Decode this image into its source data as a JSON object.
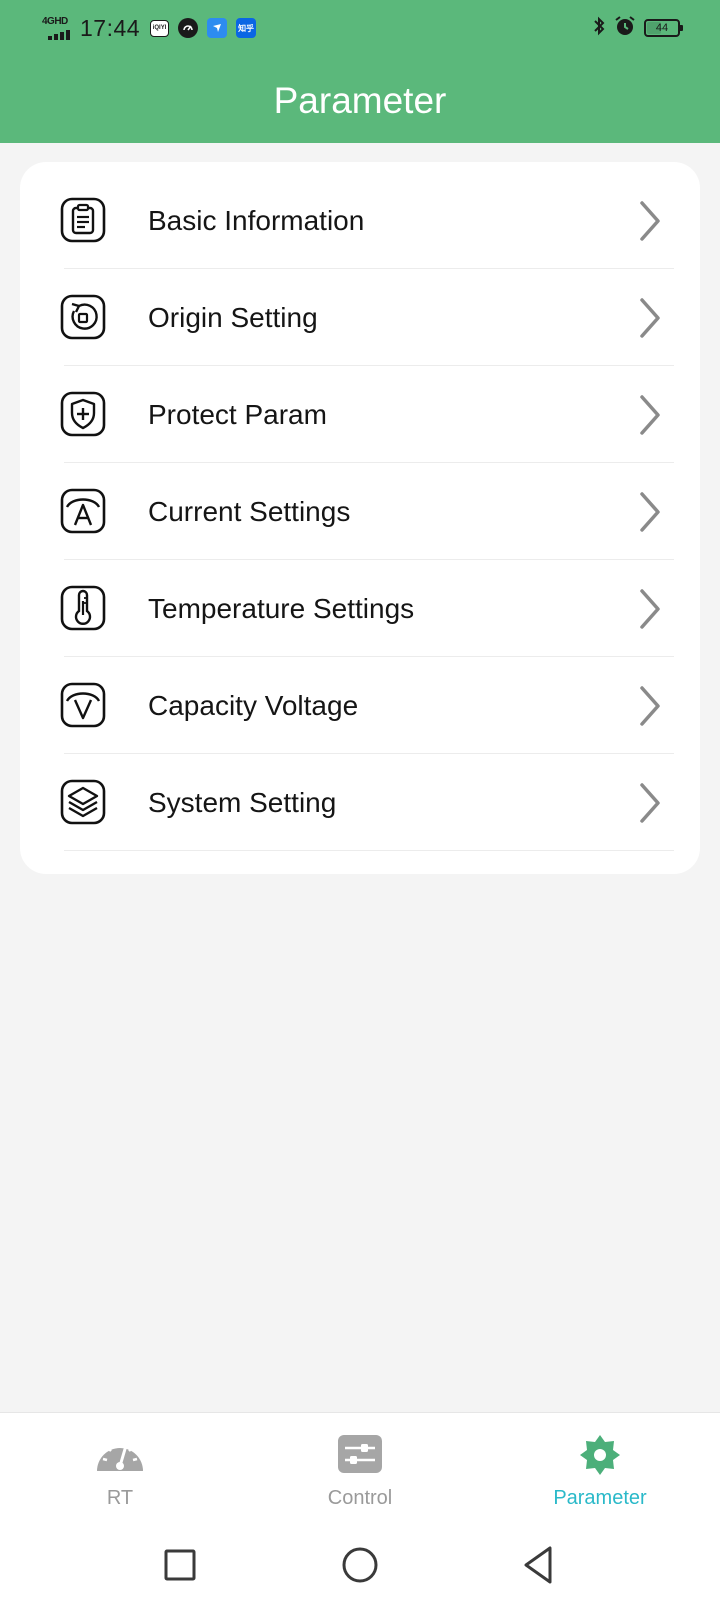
{
  "status_bar": {
    "network": "4GHD",
    "time": "17:44",
    "app_icons": [
      "iqiyi-icon",
      "speed-icon",
      "bird-app-icon",
      "zhihu-icon"
    ],
    "app_icon_labels": [
      "iQIYI",
      "",
      "",
      "知乎"
    ],
    "battery": "44",
    "right_icons": [
      "bluetooth-icon",
      "alarm-icon",
      "battery-icon"
    ]
  },
  "header": {
    "title": "Parameter",
    "background": "#5bb87b"
  },
  "menu": {
    "items": [
      {
        "label": "Basic Information",
        "icon": "clipboard-icon"
      },
      {
        "label": "Origin Setting",
        "icon": "reset-rotate-icon"
      },
      {
        "label": "Protect Param",
        "icon": "shield-plus-icon"
      },
      {
        "label": "Current Settings",
        "icon": "current-ampere-icon"
      },
      {
        "label": "Temperature Settings",
        "icon": "thermometer-icon"
      },
      {
        "label": "Capacity Voltage",
        "icon": "voltage-icon"
      },
      {
        "label": "System Setting",
        "icon": "layers-icon"
      }
    ],
    "chevron_icon": "chevron-right-icon"
  },
  "tabbar": {
    "tabs": [
      {
        "label": "RT",
        "icon": "speedometer-icon",
        "active": false
      },
      {
        "label": "Control",
        "icon": "sliders-icon",
        "active": false
      },
      {
        "label": "Parameter",
        "icon": "gear-icon",
        "active": true
      }
    ],
    "active_color": "#2ab9c9",
    "active_icon_color": "#4caf7a",
    "inactive_color": "#9a9a9a"
  },
  "navbar": {
    "buttons": [
      "recents-square-icon",
      "home-circle-icon",
      "back-triangle-icon"
    ]
  }
}
